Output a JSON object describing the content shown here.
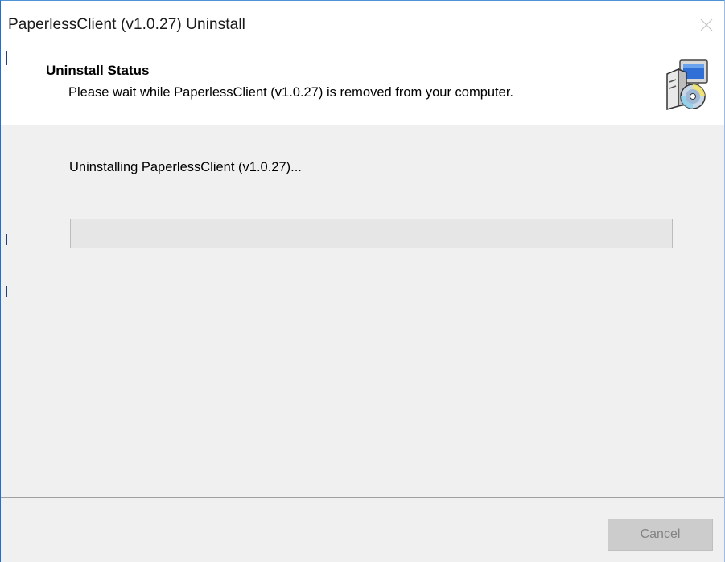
{
  "window": {
    "title": "PaperlessClient (v1.0.27) Uninstall"
  },
  "header": {
    "title": "Uninstall Status",
    "subtitle": "Please wait while PaperlessClient (v1.0.27) is removed from your computer.",
    "icon": "installer-computer-cd-icon"
  },
  "content": {
    "status": "Uninstalling PaperlessClient (v1.0.27)...",
    "progress": 0.0
  },
  "footer": {
    "cancel_label": "Cancel",
    "cancel_enabled": false
  },
  "colors": {
    "window_border": "#1e6fd0",
    "background": "#f0f0f0",
    "header_background": "#ffffff",
    "progress_track": "#e6e6e6",
    "progress_fill": "#06b025",
    "disabled_button": "#cccccc",
    "disabled_text": "#838383"
  }
}
